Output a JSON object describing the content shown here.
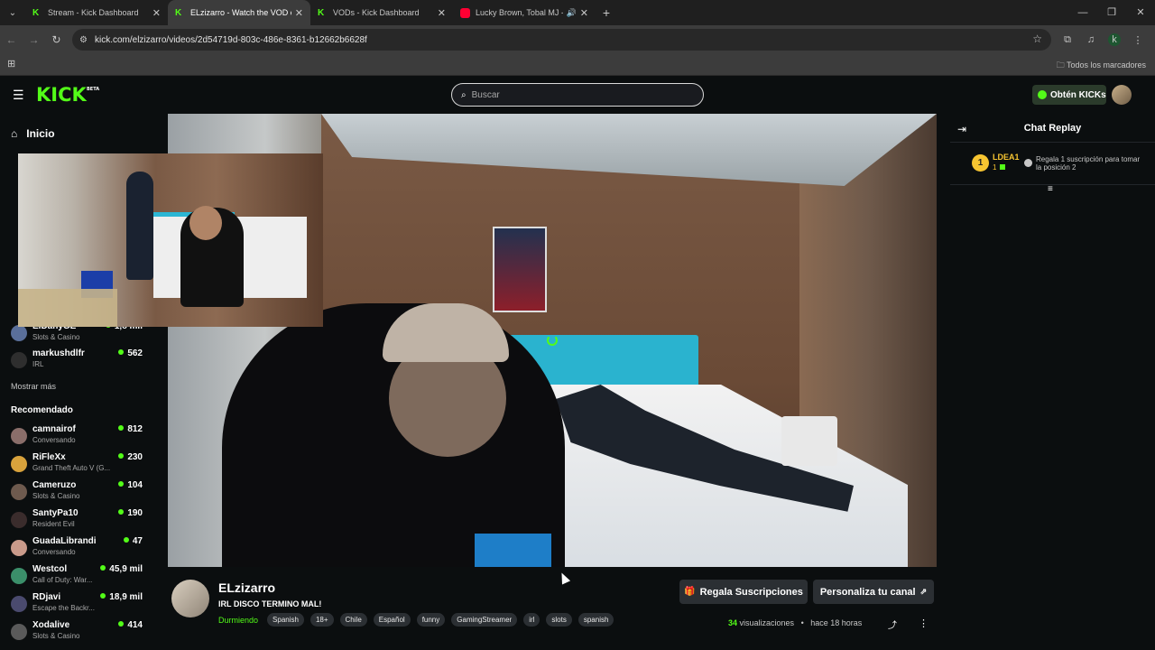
{
  "browser": {
    "tabs": [
      {
        "title": "Stream - Kick Dashboard",
        "active": false
      },
      {
        "title": "ELzizarro - Watch the VOD on K",
        "active": true
      },
      {
        "title": "VODs - Kick Dashboard",
        "active": false
      },
      {
        "title": "Lucky Brown, Tobal MJ - ZO",
        "active": false
      }
    ],
    "url": "kick.com/elzizarro/videos/2d54719d-803c-486e-8361-b12662b6628f",
    "bookmarks_label": "Todos los marcadores",
    "profile_initial": "k"
  },
  "header": {
    "logo": "KICK",
    "logo_badge": "BETA",
    "search_placeholder": "Buscar",
    "get_kicks_label": "Obtén KICKs"
  },
  "sidebar": {
    "home_label": "Inicio",
    "following": [
      {
        "name": "ElDanyGE",
        "category": "Slots & Casino",
        "viewers": "1,8 mil"
      },
      {
        "name": "markushdlfr",
        "category": "IRL",
        "viewers": "562"
      }
    ],
    "show_more": "Mostrar más",
    "recommended_label": "Recomendado",
    "recommended": [
      {
        "name": "camnairof",
        "category": "Conversando",
        "viewers": "812"
      },
      {
        "name": "RiFleXx",
        "category": "Grand Theft Auto V (G...",
        "viewers": "230"
      },
      {
        "name": "Cameruzo",
        "category": "Slots & Casino",
        "viewers": "104"
      },
      {
        "name": "SantyPa10",
        "category": "Resident Evil",
        "viewers": "190"
      },
      {
        "name": "GuadaLibrandi",
        "category": "Conversando",
        "viewers": "47"
      },
      {
        "name": "Westcol",
        "category": "Call of Duty: War...",
        "viewers": "45,9 mil"
      },
      {
        "name": "RDjavi",
        "category": "Escape the Backr...",
        "viewers": "18,9 mil"
      },
      {
        "name": "Xodalive",
        "category": "Slots & Casino",
        "viewers": "414"
      }
    ]
  },
  "chat": {
    "title": "Chat Replay",
    "gifter_rank": "1",
    "gifter_name": "LDEA1",
    "gifter_count": "1",
    "gift_message": "Regala 1 suscripción para tomar la posición 2"
  },
  "channel": {
    "name": "ELzizarro",
    "stream_title": "IRL DISCO TERMINO MAL!",
    "category": "Durmiendo",
    "tags": [
      "Spanish",
      "18+",
      "Chile",
      "Español",
      "funny",
      "GamingStreamer",
      "irl",
      "slots",
      "spanish"
    ],
    "gift_button": "Regala Suscripciones",
    "customize_button": "Personaliza tu canal",
    "views_count": "34",
    "views_label": "visualizaciones",
    "time_ago": "hace 18 horas"
  },
  "colors": {
    "brand": "#53fc18",
    "bg": "#0b0e0f",
    "gifter": "#f7c531"
  }
}
